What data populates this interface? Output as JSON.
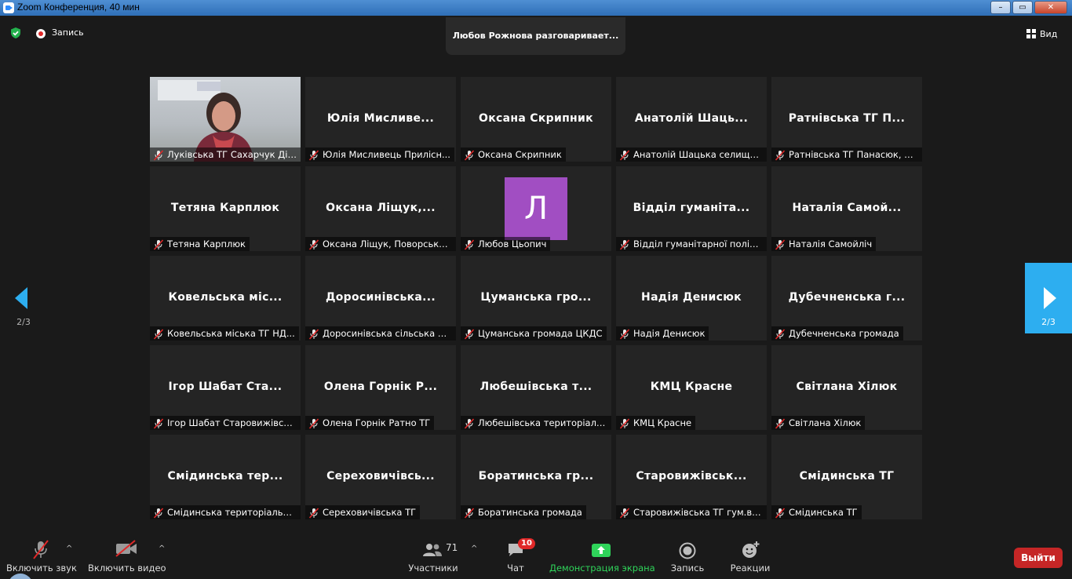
{
  "window": {
    "title": "Zoom Конференция, 40 мин",
    "controls": [
      "–",
      "▭",
      "✕"
    ]
  },
  "topbar": {
    "recording_label": "Запись",
    "speaking_banner": "Любов Рожнова разговаривает...",
    "view_label": "Вид"
  },
  "pagination": {
    "prev_page": "2/3",
    "next_page": "2/3"
  },
  "tiles": [
    {
      "big": "",
      "label": "Луківська ТГ Сахарчук Діна",
      "video": true
    },
    {
      "big": "Юлія Мисливе...",
      "label": "Юлія Мисливець Прилісн..."
    },
    {
      "big": "Оксана Скрипник",
      "label": "Оксана Скрипник"
    },
    {
      "big": "Анатолій Шаць...",
      "label": "Анатолій Шацька селищн..."
    },
    {
      "big": "Ратнівська ТГ П...",
      "label": "Ратнівська ТГ Панасюк, Ск..."
    },
    {
      "big": "Тетяна Карплюк",
      "label": "Тетяна Карплюк"
    },
    {
      "big": "Оксана Ліщук,...",
      "label": "Оксана Ліщук, Поворська..."
    },
    {
      "big": "",
      "label": "Любов Цьопич",
      "avatar": "Л"
    },
    {
      "big": "Відділ гуманіта...",
      "label": "Відділ гуманітарної політи..."
    },
    {
      "big": "Наталія Самой...",
      "label": "Наталія Самойліч"
    },
    {
      "big": "Ковельська міс...",
      "label": "Ковельська міська ТГ НД..."
    },
    {
      "big": "Доросинівська...",
      "label": "Доросинівська сільська р..."
    },
    {
      "big": "Цуманська гро...",
      "label": "Цуманська громада ЦКДС"
    },
    {
      "big": "Надія Денисюк",
      "label": "Надія Денисюк"
    },
    {
      "big": "Дубечненська г...",
      "label": "Дубечненська громада"
    },
    {
      "big": "Ігор Шабат Ста...",
      "label": "Ігор Шабат Старовижівсь..."
    },
    {
      "big": "Олена Горнік Р...",
      "label": "Олена Горнік Ратно ТГ"
    },
    {
      "big": "Любешівська т...",
      "label": "Любешівська територіаль..."
    },
    {
      "big": "КМЦ Красне",
      "label": "КМЦ Красне"
    },
    {
      "big": "Світлана Хілюк",
      "label": "Світлана Хілюк"
    },
    {
      "big": "Смідинська тер...",
      "label": "Смідинська територіальна..."
    },
    {
      "big": "Сереховичівсь...",
      "label": "Сереховичівська ТГ"
    },
    {
      "big": "Боратинська гр...",
      "label": "Боратинська громада"
    },
    {
      "big": "Старовижівськ...",
      "label": "Старовижівська ТГ гум.від..."
    },
    {
      "big": "Смідинська ТГ",
      "label": "Смідинська ТГ"
    }
  ],
  "toolbar": {
    "unmute_label": "Включить звук",
    "start_video_label": "Включить видео",
    "participants_label": "Участники",
    "participants_count": "71",
    "chat_label": "Чат",
    "chat_badge": "10",
    "share_label": "Демонстрация экрана",
    "record_label": "Запись",
    "reactions_label": "Реакции",
    "caret": "^",
    "leave_label": "Выйти"
  },
  "colors": {
    "accent_blue": "#2daef0",
    "share_green": "#2fd45a",
    "leave_red": "#c52626",
    "avatar_purple": "#a14ec2",
    "muted_red": "#e02828"
  }
}
